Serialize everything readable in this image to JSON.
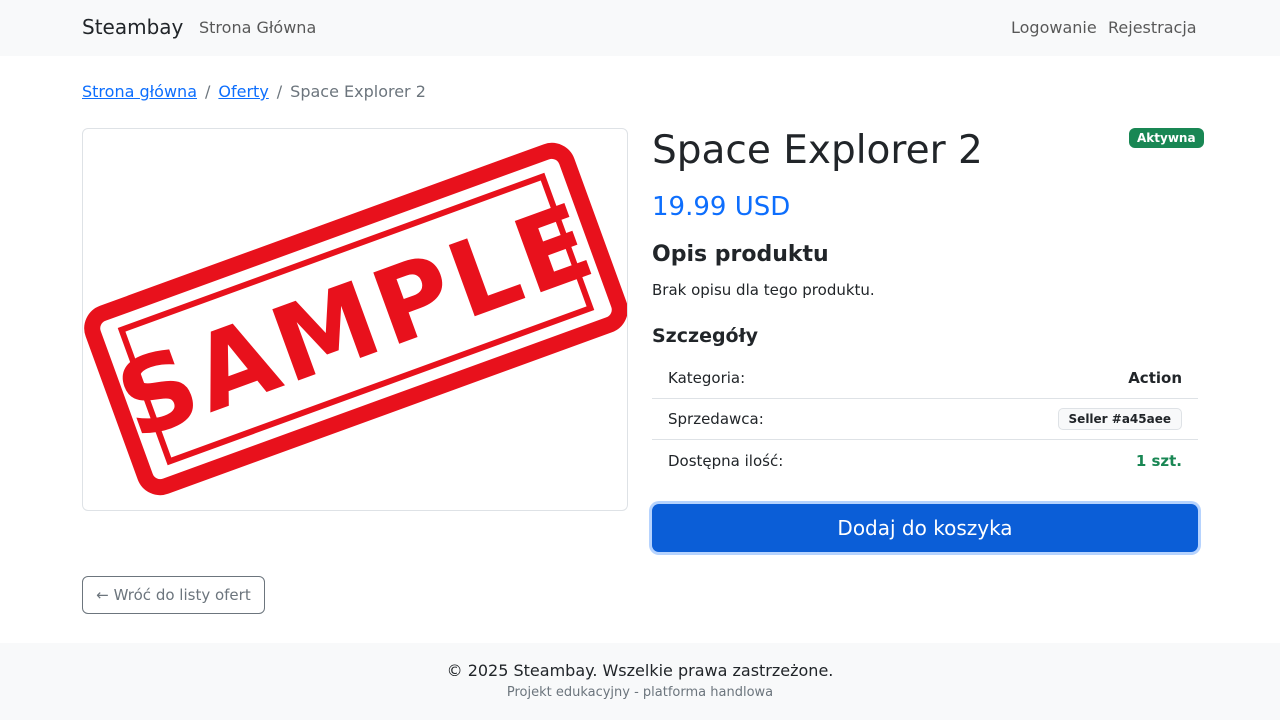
{
  "navbar": {
    "brand": "Steambay",
    "home": "Strona Główna",
    "login": "Logowanie",
    "register": "Rejestracja"
  },
  "breadcrumb": {
    "home": "Strona główna",
    "sep1": "/",
    "offers": "Oferty",
    "sep2": "/",
    "current": "Space Explorer 2"
  },
  "product": {
    "image_text": "SAMPLE",
    "title": "Space Explorer 2",
    "status_badge": "Aktywna",
    "price": "19.99 USD",
    "description_heading": "Opis produktu",
    "description": "Brak opisu dla tego produktu.",
    "details_heading": "Szczegóły",
    "details": {
      "category_label": "Kategoria:",
      "category_value": "Action",
      "seller_label": "Sprzedawca:",
      "seller_value": "Seller #a45aee",
      "quantity_label": "Dostępna ilość:",
      "quantity_value": "1 szt."
    },
    "add_to_cart": "Dodaj do koszyka"
  },
  "back_button": "← Wróć do listy ofert",
  "footer": {
    "copyright": "© 2025 Steambay. Wszelkie prawa zastrzeżone.",
    "subtitle": "Projekt edukacyjny - platforma handlowa"
  },
  "colors": {
    "primary": "#0d6efd",
    "success": "#198754",
    "stamp": "#e8111c"
  }
}
